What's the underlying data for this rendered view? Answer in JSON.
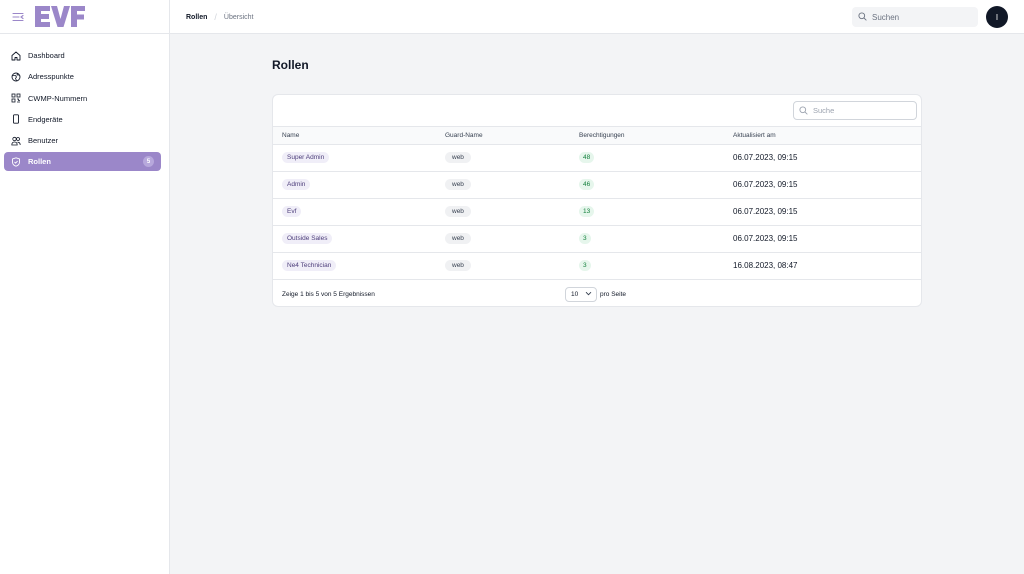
{
  "logo_text": "EVF",
  "breadcrumb": {
    "section": "Rollen",
    "page": "Übersicht"
  },
  "global_search": {
    "placeholder": "Suchen"
  },
  "user": {
    "initial": "I"
  },
  "sidebar": {
    "items": [
      {
        "label": "Dashboard",
        "icon": "home-icon"
      },
      {
        "label": "Adresspunkte",
        "icon": "globe-icon"
      },
      {
        "label": "CWMP-Nummern",
        "icon": "qr-code-icon"
      },
      {
        "label": "Endgeräte",
        "icon": "device-icon"
      },
      {
        "label": "Benutzer",
        "icon": "users-icon"
      },
      {
        "label": "Rollen",
        "icon": "shield-icon",
        "active": true,
        "badge": "5"
      }
    ]
  },
  "page_title": "Rollen",
  "table": {
    "search_placeholder": "Suche",
    "columns": [
      "Name",
      "Guard-Name",
      "Berechtigungen",
      "Aktualisiert am"
    ],
    "rows": [
      {
        "name": "Super Admin",
        "guard": "web",
        "permissions": "48",
        "updated": "06.07.2023, 09:15"
      },
      {
        "name": "Admin",
        "guard": "web",
        "permissions": "46",
        "updated": "06.07.2023, 09:15"
      },
      {
        "name": "Evf",
        "guard": "web",
        "permissions": "13",
        "updated": "06.07.2023, 09:15"
      },
      {
        "name": "Outside Sales",
        "guard": "web",
        "permissions": "3",
        "updated": "06.07.2023, 09:15"
      },
      {
        "name": "Ne4 Technician",
        "guard": "web",
        "permissions": "3",
        "updated": "16.08.2023, 08:47"
      }
    ],
    "footer": {
      "summary": "Zeige 1 bis 5 von 5 Ergebnissen",
      "per_page_value": "10",
      "per_page_label": "pro Seite"
    }
  },
  "colors": {
    "accent": "#9b87c9",
    "logo": "#9b87c9",
    "sidebar_bg": "#ffffff",
    "content_bg": "#f3f4f6",
    "count_green": "#15803d"
  }
}
